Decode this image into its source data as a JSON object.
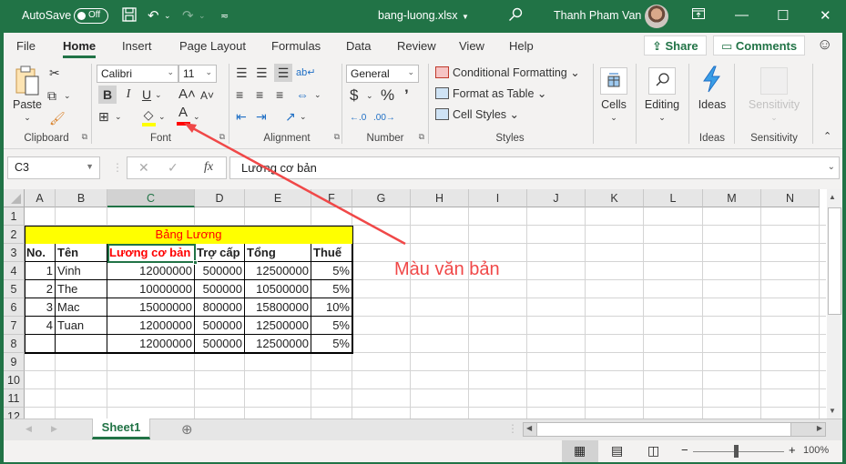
{
  "titlebar": {
    "autosave_label": "AutoSave",
    "autosave_state": "Off",
    "filename": "bang-luong.xlsx",
    "user_name": "Thanh Pham Van",
    "icons": [
      "save-icon",
      "undo-icon",
      "redo-icon",
      "customize-qat-icon",
      "search-icon",
      "ribbon-display-icon",
      "minimize-icon",
      "maximize-icon",
      "close-icon"
    ]
  },
  "tabs": [
    {
      "label": "File"
    },
    {
      "label": "Home",
      "active": true
    },
    {
      "label": "Insert"
    },
    {
      "label": "Page Layout"
    },
    {
      "label": "Formulas"
    },
    {
      "label": "Data"
    },
    {
      "label": "Review"
    },
    {
      "label": "View"
    },
    {
      "label": "Help"
    }
  ],
  "share_label": "Share",
  "comments_label": "Comments",
  "ribbon": {
    "clipboard": {
      "label": "Clipboard",
      "paste_label": "Paste"
    },
    "font": {
      "label": "Font",
      "font_name": "Calibri",
      "font_size": "11",
      "bold": "B",
      "italic": "I",
      "underline": "U",
      "grow": "A˄",
      "shrink": "A˅",
      "font_color_char": "A",
      "fill_color": "#ffff00",
      "font_color": "#ff0000"
    },
    "alignment": {
      "label": "Alignment"
    },
    "number": {
      "label": "Number",
      "format": "General",
      "currency": "$",
      "percent": "%",
      "comma": "’"
    },
    "styles": {
      "label": "Styles",
      "conditional": "Conditional Formatting",
      "format_table": "Format as Table",
      "cell_styles": "Cell Styles"
    },
    "cells": {
      "label": "Cells"
    },
    "editing": {
      "label": "Editing"
    },
    "ideas": {
      "label": "Ideas",
      "group_label": "Ideas"
    },
    "sensitivity": {
      "label": "Sensitivity",
      "group_label": "Sensitivity"
    }
  },
  "formula_bar": {
    "name_box": "C3",
    "fx": "fx",
    "content": "Lương cơ bản"
  },
  "columns": [
    "A",
    "B",
    "C",
    "D",
    "E",
    "F",
    "G",
    "H",
    "I",
    "J",
    "K",
    "L",
    "M",
    "N"
  ],
  "selected_column": "C",
  "rows": [
    "1",
    "2",
    "3",
    "4",
    "5",
    "6",
    "7",
    "8",
    "9",
    "10",
    "11",
    "12"
  ],
  "table": {
    "title": "Bảng Lương",
    "title_color": "#ff0000",
    "title_fill": "#ffff00",
    "headers": [
      "No.",
      "Tên",
      "Lương cơ bản",
      "Trợ cấp",
      "Tổng",
      "Thuế"
    ],
    "rows": [
      [
        "1",
        "Vinh",
        "12000000",
        "500000",
        "12500000",
        "5%"
      ],
      [
        "2",
        "The",
        "10000000",
        "500000",
        "10500000",
        "5%"
      ],
      [
        "3",
        "Mac",
        "15000000",
        "800000",
        "15800000",
        "10%"
      ],
      [
        "4",
        "Tuan",
        "12000000",
        "500000",
        "12500000",
        "5%"
      ],
      [
        "",
        "",
        "12000000",
        "500000",
        "12500000",
        "5%"
      ]
    ]
  },
  "sheet_tab": "Sheet1",
  "status": {
    "zoom": "100%",
    "zoom_slider_percent": 100
  },
  "annotation": {
    "text": "Màu văn bản",
    "color": "#f04848"
  }
}
